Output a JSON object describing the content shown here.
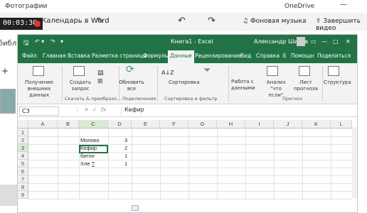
{
  "photos": {
    "app_title": "Фотографии",
    "onedrive_label": "OneDrive",
    "recorder_time": "00:03:30",
    "video_title": "Календарь в Word",
    "music_button": "Фоновая музыка",
    "finish_button": "Завершить видео",
    "sidebar_text": "библи"
  },
  "excel": {
    "window_title": "Книга1 - Excel",
    "user_name": "Александр Шихов",
    "title_buttons": [
      "▭",
      "—",
      "▢",
      "✕"
    ],
    "tabs": [
      "Файл",
      "Главная",
      "Вставка",
      "Разметка страницы",
      "Формулы",
      "Данные",
      "Рецензирование",
      "Вид",
      "Справка",
      "Помощн",
      "Поделиться"
    ],
    "active_tab": "Данные",
    "ribbon": {
      "get_data": "Получение\nвнешних данных",
      "create_query": "Создать\nзапрос",
      "refresh_all": "Обновить\nвсе",
      "sort": "Сортировка",
      "filter": "",
      "data_tools": "Работа с\nданными",
      "what_if": "Анализ \"что\nесли\"",
      "forecast": "Лист\nпрогноза",
      "outline": "Структура",
      "group_get_transform": "Скачать & преобразо...",
      "group_connections": "Подключения",
      "group_sort_filter": "Сортировка и фильтр",
      "group_forecast": "Прогноз"
    },
    "name_box": "C3",
    "formula_value": "Кефир",
    "columns": [
      "A",
      "B",
      "C",
      "D",
      "E",
      "F",
      "G",
      "H",
      "I",
      "J",
      "K",
      "L"
    ],
    "rows": [
      "1",
      "2",
      "3",
      "4",
      "5",
      "6",
      "7",
      "8",
      "9"
    ],
    "cells": {
      "C2": "Молоко",
      "D2": "3",
      "C3": "Кефир",
      "D3": "2",
      "C4": "батон",
      "D4": "1",
      "C5": "Хле",
      "D5": "1"
    }
  }
}
